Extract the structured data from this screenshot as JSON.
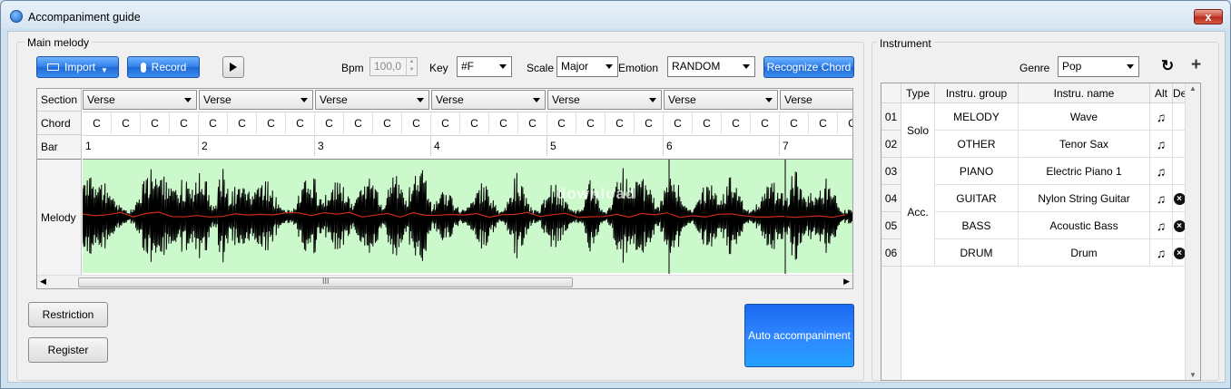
{
  "window": {
    "title": "Accompaniment guide",
    "close_label": "x"
  },
  "main": {
    "legend": "Main melody",
    "import_label": "Import",
    "record_label": "Record",
    "bpm_label": "Bpm",
    "bpm_value": "100,0",
    "key_label": "Key",
    "key_value": "#F",
    "scale_label": "Scale",
    "scale_value": "Major",
    "emotion_label": "Emotion",
    "emotion_value": "RANDOM",
    "recognize_label": "Recognize Chord",
    "row_section": "Section",
    "row_chord": "Chord",
    "row_bar": "Bar",
    "row_melody": "Melody",
    "sections": [
      "Verse",
      "Verse",
      "Verse",
      "Verse",
      "Verse",
      "Verse",
      "Verse"
    ],
    "chords": [
      "C",
      "C",
      "C",
      "C",
      "C",
      "C",
      "C",
      "C",
      "C",
      "C",
      "C",
      "C",
      "C",
      "C",
      "C",
      "C",
      "C",
      "C",
      "C",
      "C",
      "C",
      "C",
      "C",
      "C",
      "C",
      "C",
      "C"
    ],
    "bars": [
      "1",
      "2",
      "3",
      "4",
      "5",
      "6",
      "7"
    ],
    "scroll_thumb_label": "III",
    "restriction_label": "Restriction",
    "register_label": "Register",
    "auto_label": "Auto accompaniment",
    "watermark": "download"
  },
  "instrument": {
    "legend": "Instrument",
    "genre_label": "Genre",
    "genre_value": "Pop",
    "headers": {
      "type": "Type",
      "group": "Instru. group",
      "name": "Instru. name",
      "alt": "Alt",
      "del": "Del"
    },
    "type_solo": "Solo",
    "type_acc": "Acc.",
    "rows": [
      {
        "num": "01",
        "group": "MELODY",
        "name": "Wave",
        "deletable": false
      },
      {
        "num": "02",
        "group": "OTHER",
        "name": "Tenor Sax",
        "deletable": false
      },
      {
        "num": "03",
        "group": "PIANO",
        "name": "Electric Piano 1",
        "deletable": false
      },
      {
        "num": "04",
        "group": "GUITAR",
        "name": "Nylon String Guitar",
        "deletable": true
      },
      {
        "num": "05",
        "group": "BASS",
        "name": "Acoustic Bass",
        "deletable": true
      },
      {
        "num": "06",
        "group": "DRUM",
        "name": "Drum",
        "deletable": true
      }
    ]
  },
  "colors": {
    "accent": "#2f7ee8",
    "melody_bg": "#ccf9cc",
    "pitch_line": "#cc2a1a"
  }
}
